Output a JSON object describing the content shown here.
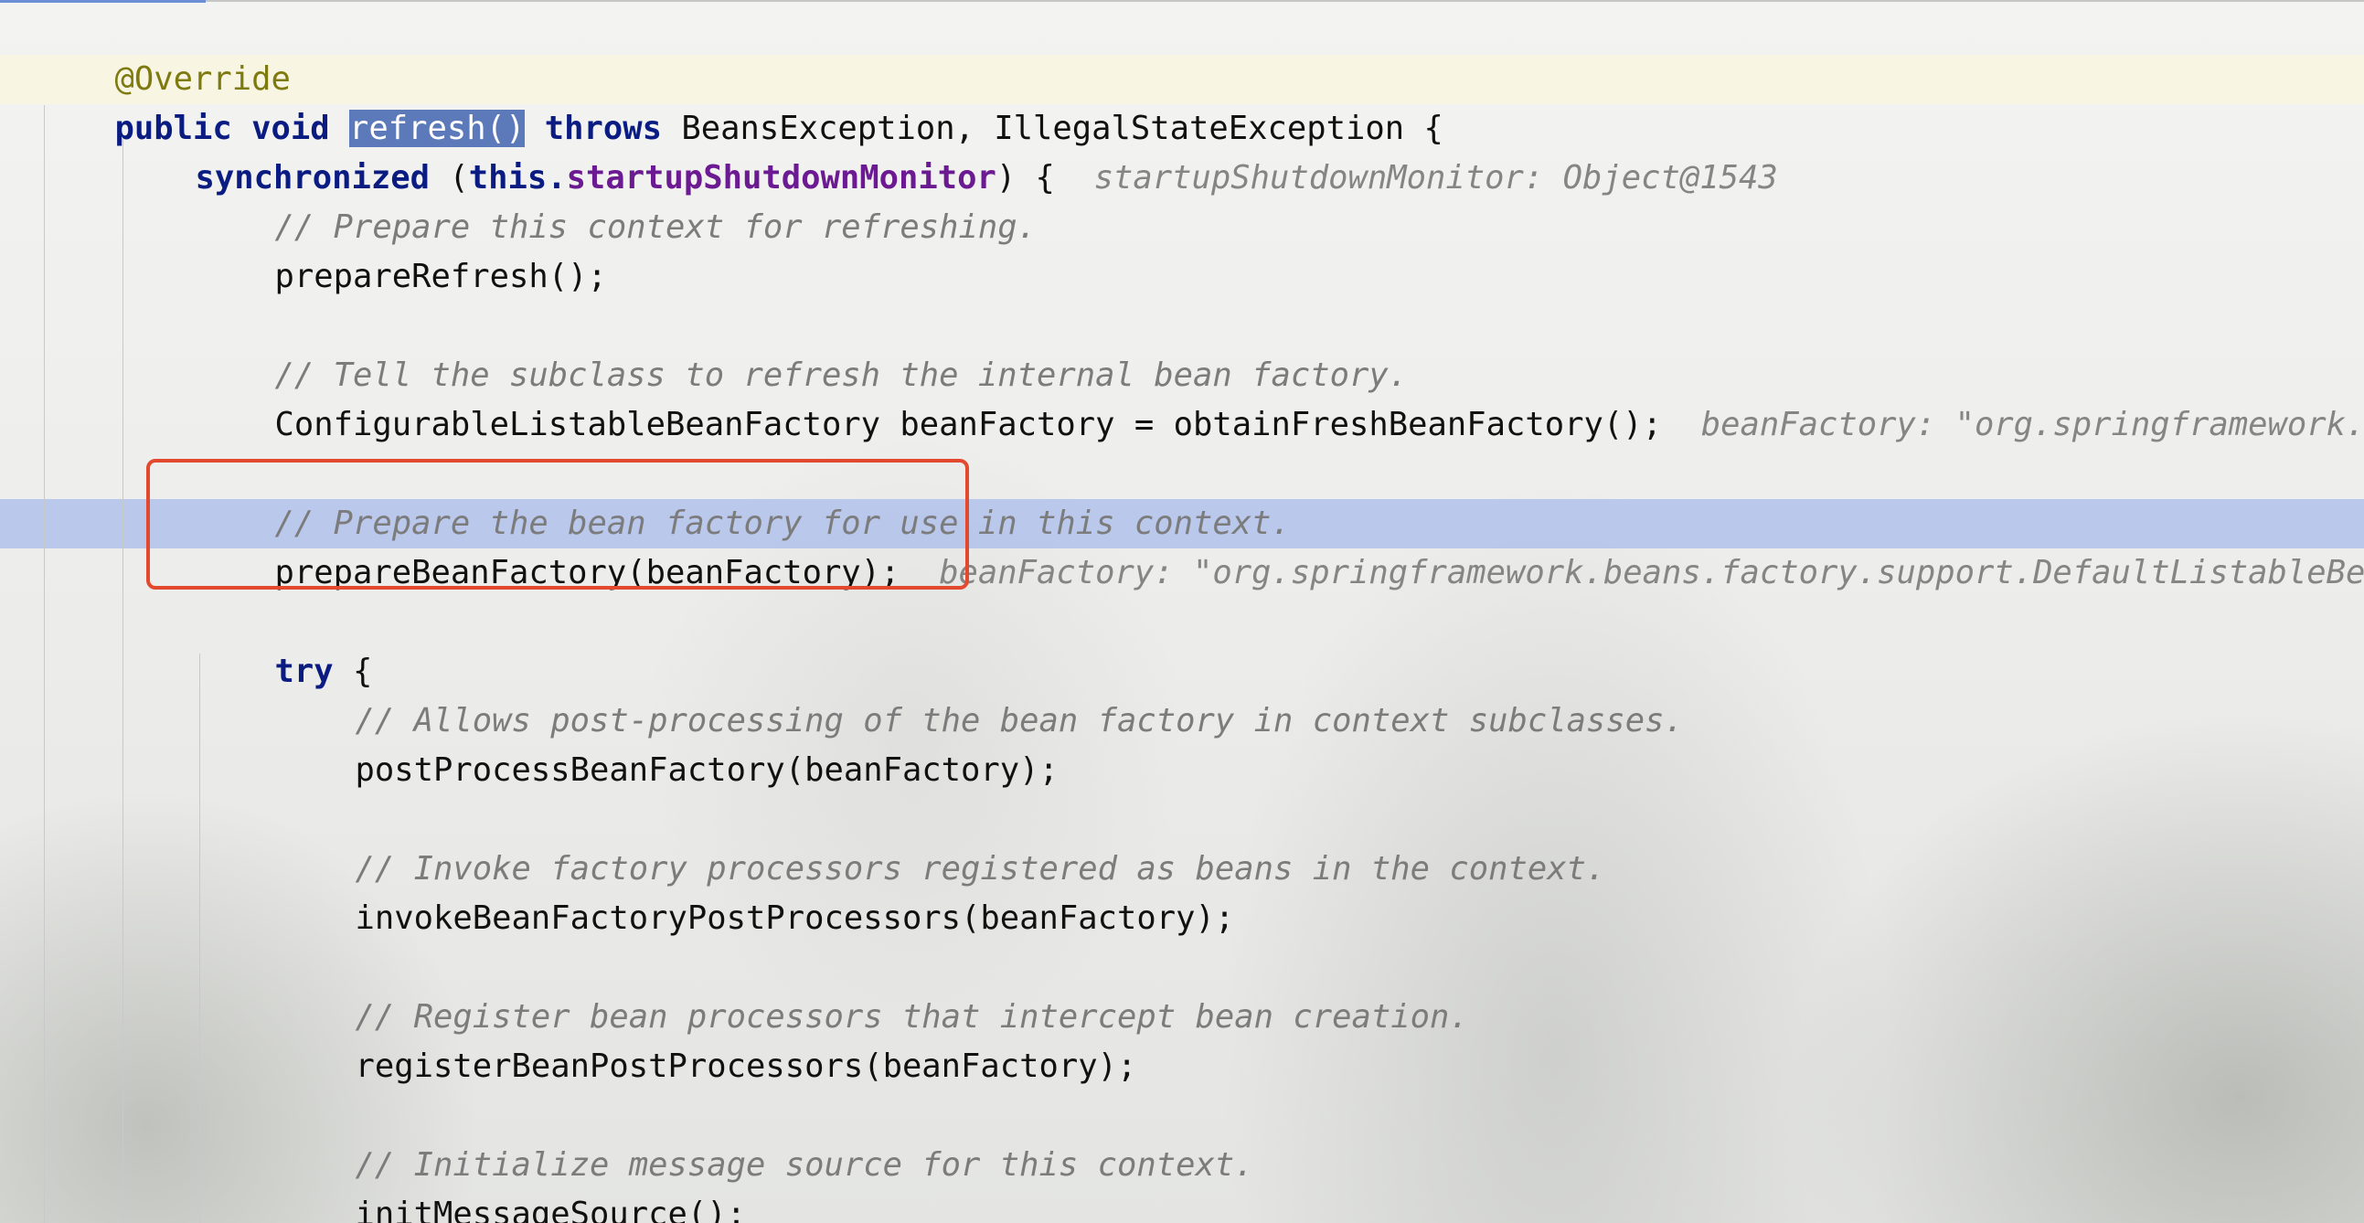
{
  "code": {
    "l01": {
      "anno": "@Override"
    },
    "l02": {
      "kw1": "public void",
      "sp1": " ",
      "name": "refresh()",
      "sp2": " ",
      "kw2": "throws",
      "rest": " BeansException, IllegalStateException {"
    },
    "l03": {
      "kw1": "synchronized",
      "p1": " (",
      "kw2": "this",
      "dot": ".",
      "field": "startupShutdownMonitor",
      "p2": ") {  ",
      "hint": "startupShutdownMonitor: Object@1543"
    },
    "l04": {
      "cmt": "// Prepare this context for refreshing."
    },
    "l05": {
      "code": "prepareRefresh();"
    },
    "l06": {
      "cmt": "// Tell the subclass to refresh the internal bean factory."
    },
    "l07": {
      "code": "ConfigurableListableBeanFactory beanFactory = obtainFreshBeanFactory();  ",
      "hint": "beanFactory: \"org.springframework.b"
    },
    "l08": {
      "cmt": "// Prepare the bean factory for use in this context."
    },
    "l09": {
      "code": "prepareBeanFactory(beanFactory);  ",
      "hint": "beanFactory: \"org.springframework.beans.factory.support.DefaultListableBea"
    },
    "l10": {
      "kw": "try",
      "rest": " {"
    },
    "l11": {
      "cmt": "// Allows post-processing of the bean factory in context subclasses."
    },
    "l12": {
      "code": "postProcessBeanFactory(beanFactory);"
    },
    "l13": {
      "cmt": "// Invoke factory processors registered as beans in the context."
    },
    "l14": {
      "code": "invokeBeanFactoryPostProcessors(beanFactory);"
    },
    "l15": {
      "cmt": "// Register bean processors that intercept bean creation."
    },
    "l16": {
      "code": "registerBeanPostProcessors(beanFactory);"
    },
    "l17": {
      "cmt": "// Initialize message source for this context."
    },
    "l18": {
      "code": "initMessageSource();"
    }
  },
  "colors": {
    "keyword": "#0a1c82",
    "annotation": "#7e7a10",
    "field": "#6b1a92",
    "comment": "#7c7c7c",
    "inline_hint": "#858585",
    "execution_line": "#aec0ec",
    "selection": "#5c79ba",
    "callout_box": "#e2492f"
  }
}
